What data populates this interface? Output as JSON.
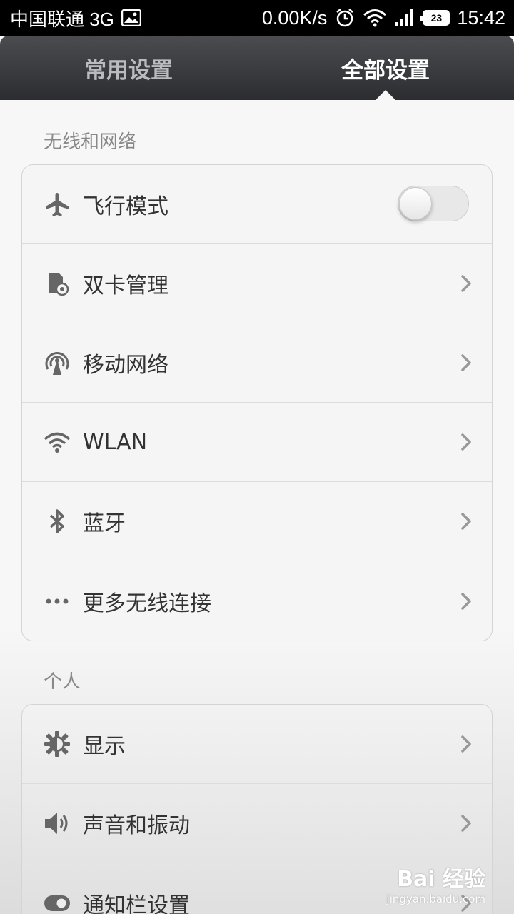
{
  "status_bar": {
    "carrier": "中国联通 3G",
    "speed": "0.00K/s",
    "battery": "23",
    "time": "15:42"
  },
  "tabs": [
    {
      "label": "常用设置",
      "active": false
    },
    {
      "label": "全部设置",
      "active": true
    }
  ],
  "sections": [
    {
      "header": "无线和网络",
      "items": [
        {
          "label": "飞行模式",
          "icon": "airplane-icon",
          "toggle": false
        },
        {
          "label": "双卡管理",
          "icon": "sim-card-icon"
        },
        {
          "label": "移动网络",
          "icon": "cellular-antenna-icon"
        },
        {
          "label": "WLAN",
          "icon": "wifi-icon"
        },
        {
          "label": "蓝牙",
          "icon": "bluetooth-icon"
        },
        {
          "label": "更多无线连接",
          "icon": "more-dots-icon"
        }
      ]
    },
    {
      "header": "个人",
      "items": [
        {
          "label": "显示",
          "icon": "brightness-icon"
        },
        {
          "label": "声音和振动",
          "icon": "speaker-icon"
        },
        {
          "label": "通知栏设置",
          "icon": "toggle-switch-icon"
        }
      ]
    }
  ],
  "watermark": {
    "logo": "Bai 经验",
    "url": "jingyan.baidu.com"
  },
  "colors": {
    "tab_bar": "#3a3c40",
    "background": "#f7f7f7",
    "text": "#333333",
    "section_header": "#888888"
  }
}
